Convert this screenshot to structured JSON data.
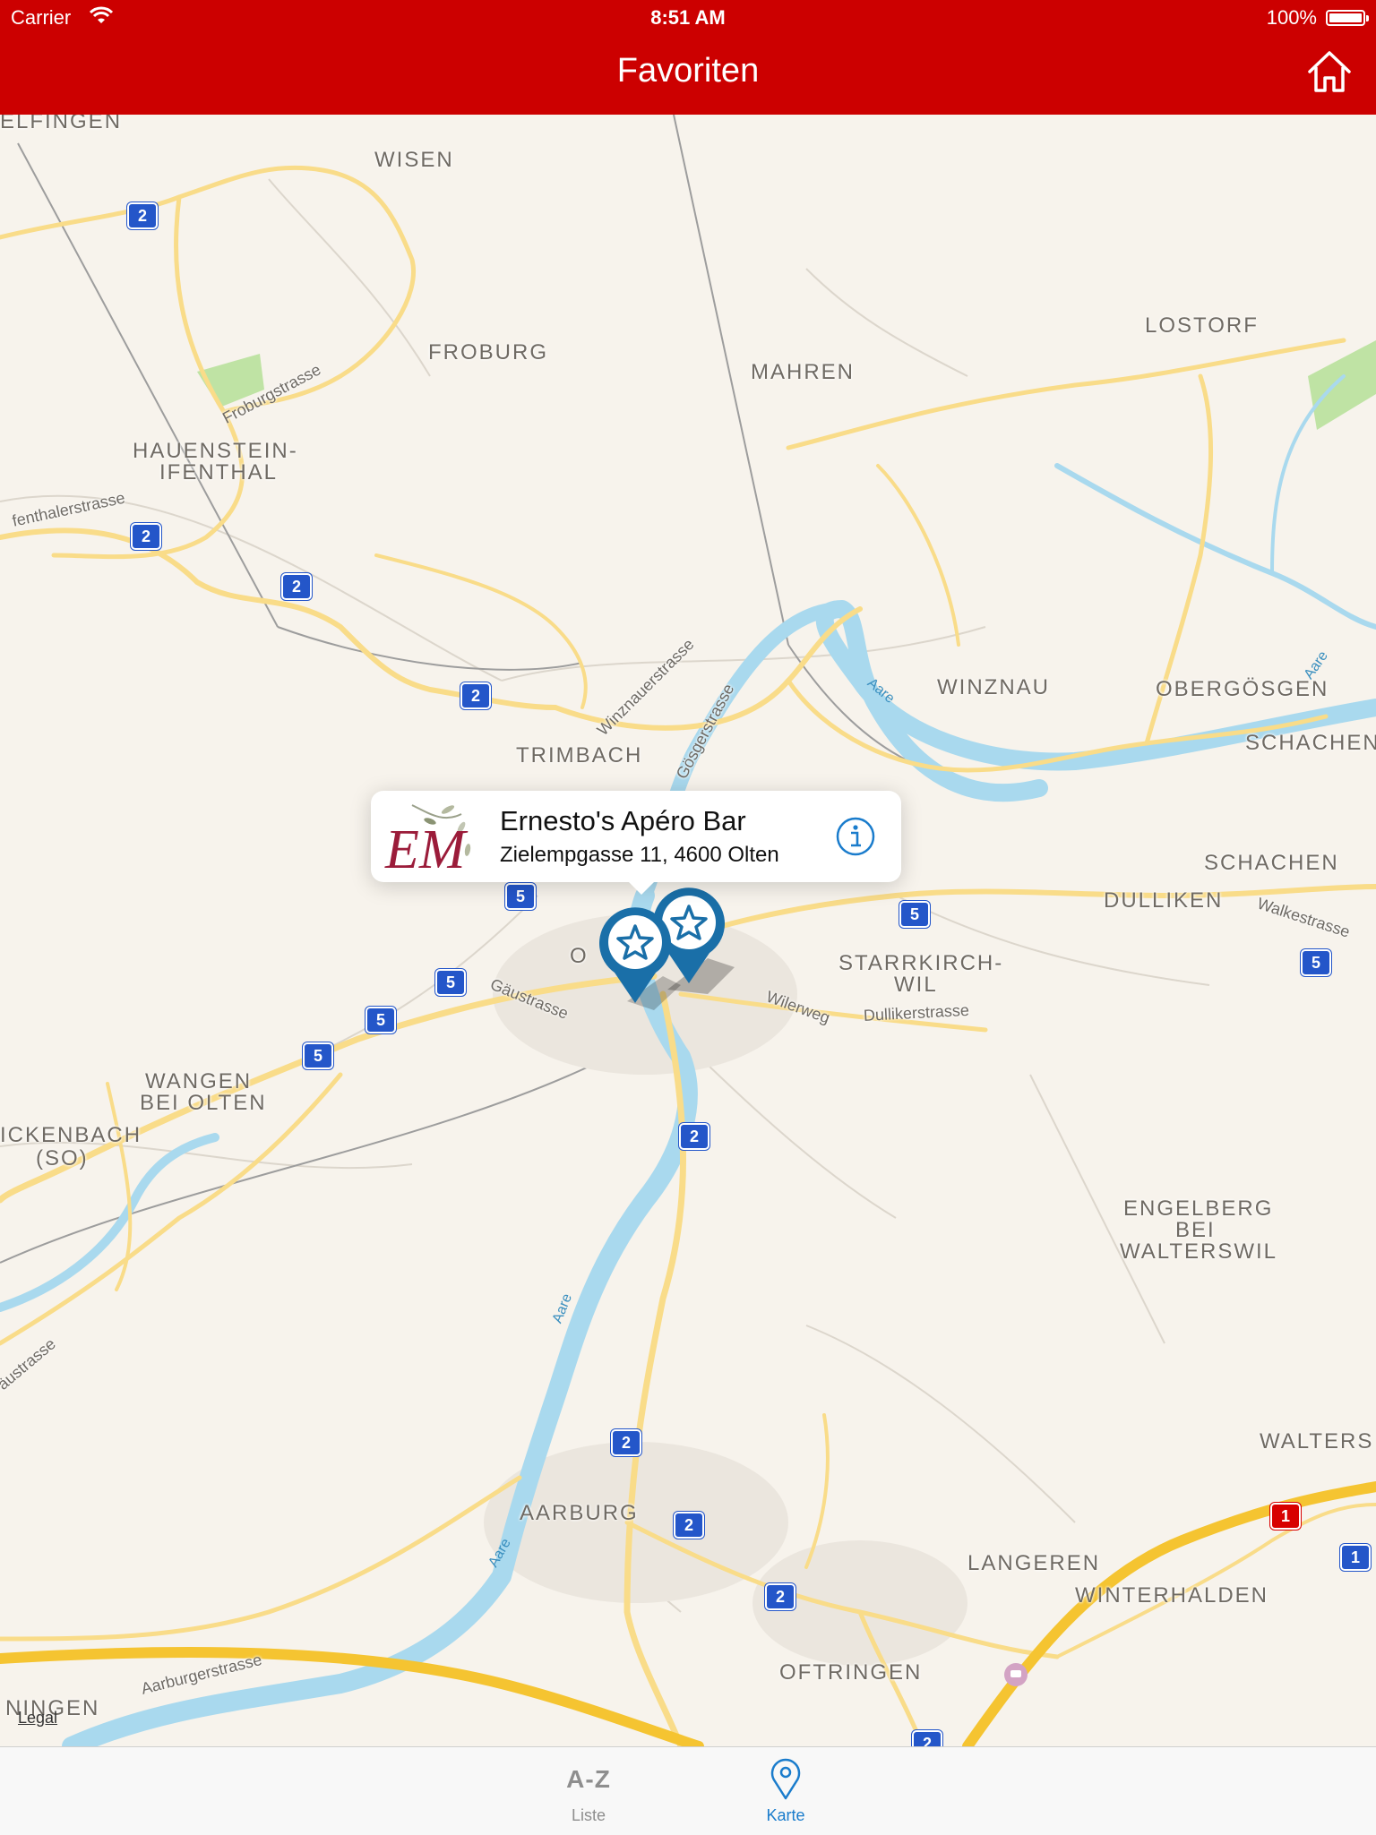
{
  "status_bar": {
    "carrier": "Carrier",
    "time": "8:51 AM",
    "battery": "100%"
  },
  "nav": {
    "title": "Favoriten",
    "home_icon": "home-icon"
  },
  "map": {
    "places": {
      "elfingen": "ELFINGEN",
      "wisen": "WISEN",
      "froburg": "FROBURG",
      "mahren": "MAHREN",
      "lostorf": "LOSTORF",
      "hauenstein1": "HAUENSTEIN-",
      "hauenstein2": "IFENTHAL",
      "winznau": "WINZNAU",
      "obergoesgen": "OBERGÖSGEN",
      "trimbach": "TRIMBACH",
      "schachen1": "SCHACHEN",
      "schachen2": "SCHACHEN",
      "dulliken": "DULLIKEN",
      "olten": "O",
      "starrkirch1": "STARRKIRCH-",
      "starrkirch2": "WIL",
      "wangen1": "WANGEN",
      "wangen2": "BEI OLTEN",
      "kappel1": "ICKENBACH",
      "kappel2": "(SO)",
      "engelberg1": "ENGELBERG",
      "engelberg2": "BEI",
      "engelberg3": "WALTERSWIL",
      "walters": "WALTERS",
      "aarburg": "AARBURG",
      "langeren": "LANGEREN",
      "winterhalden": "WINTERHALDEN",
      "oftringen": "OFTRINGEN",
      "ningen": "NINGEN"
    },
    "streets": {
      "froburgstrasse": "Froburgstrasse",
      "ifenthalerstrasse": "fenthalerstrasse",
      "winznauerstrasse": "Winznauerstrasse",
      "goesgerstrasse": "Gösgerstrasse",
      "gaeustrasse": "Gäustrasse",
      "wilerweg": "Wilerweg",
      "dullikerstrasse": "Dullikerstrasse",
      "walkestrasse": "Walkestrasse",
      "aarburgerstrasse": "Aarburgerstrasse",
      "gaeustrasse2": "äustrasse"
    },
    "river": {
      "aare": "Aare"
    },
    "shields": {
      "s1": "2",
      "s2": "2",
      "s3": "2",
      "s4": "2",
      "s5": "5",
      "s6": "5",
      "s7": "5",
      "s8": "5",
      "s9": "5",
      "s10": "5",
      "s11": "2",
      "s12": "2",
      "s13": "2",
      "s14": "2",
      "s15": "1",
      "s16": "1",
      "s17": "2"
    },
    "legal": "Legal"
  },
  "callout": {
    "title": "Ernesto's Apéro Bar",
    "subtitle": "Zielempgasse 11, 4600 Olten",
    "logo_text": "EM"
  },
  "tabbar": {
    "tabs": [
      {
        "icon": "A-Z",
        "label": "Liste",
        "selected": false
      },
      {
        "icon": "map-pin-icon",
        "label": "Karte",
        "selected": true
      }
    ]
  },
  "colors": {
    "brand_red": "#cc0000",
    "pin_blue": "#1a6fa8",
    "tab_active": "#1a7ccc"
  }
}
